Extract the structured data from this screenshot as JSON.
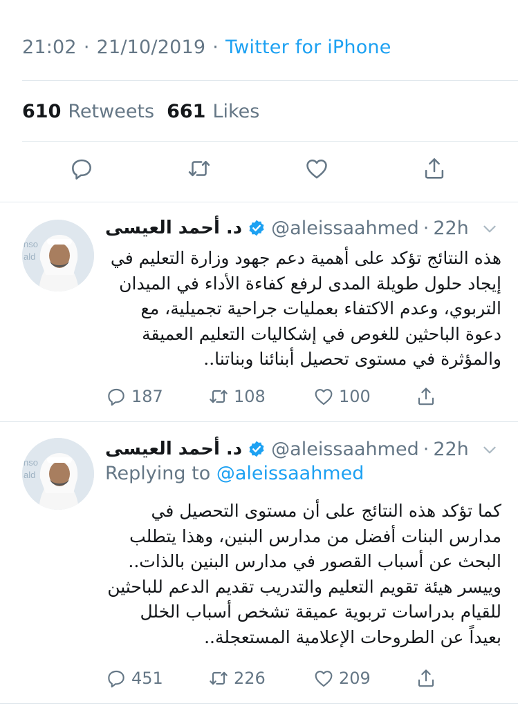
{
  "detail": {
    "time": "21:02",
    "date": "21/10/2019",
    "source": "Twitter for iPhone",
    "separator": "·",
    "retweets_count": "610",
    "retweets_label": "Retweets",
    "likes_count": "661",
    "likes_label": "Likes"
  },
  "tweets": [
    {
      "display_name": "د. أحمد العيسى",
      "handle": "@aleissaahmed",
      "dot": "·",
      "time": "22h",
      "replying_label": "",
      "replying_to": "",
      "lines": [
        "هذه النتائج تؤكد على أهمية دعم جهود وزارة التعليم في",
        "إيجاد حلول طويلة المدى لرفع كفاءة الأداء في الميدان",
        "التربوي، وعدم الاكتفاء بعمليات جراحية تجميلية، مع",
        "دعوة الباحثين للغوص في إشكاليات التعليم العميقة",
        "والمؤثرة في مستوى تحصيل أبنائنا وبناتنا.."
      ],
      "replies": "187",
      "retweets": "108",
      "likes": "100"
    },
    {
      "display_name": "د. أحمد العيسى",
      "handle": "@aleissaahmed",
      "dot": "·",
      "time": "22h",
      "replying_label": "Replying to",
      "replying_to": "@aleissaahmed",
      "lines": [
        "كما تؤكد هذه النتائج على أن مستوى التحصيل في",
        "مدارس البنات أفضل من مدارس البنين، وهذا يتطلب",
        "البحث عن أسباب القصور في مدارس البنين بالذات..",
        "وييسر هيئة تقويم التعليم والتدريب تقديم الدعم للباحثين",
        "للقيام بدراسات تربوية عميقة تشخص أسباب الخلل",
        "بعيداً عن الطروحات الإعلامية المستعجلة.."
      ],
      "replies": "451",
      "retweets": "226",
      "likes": "209"
    }
  ],
  "colors": {
    "accent": "#1da1f2",
    "muted": "#657786",
    "text": "#14171a",
    "divider": "#e1e8ed"
  },
  "icons": [
    "reply-icon",
    "retweet-icon",
    "like-icon",
    "share-icon",
    "verified-badge-icon",
    "chevron-down-icon"
  ]
}
